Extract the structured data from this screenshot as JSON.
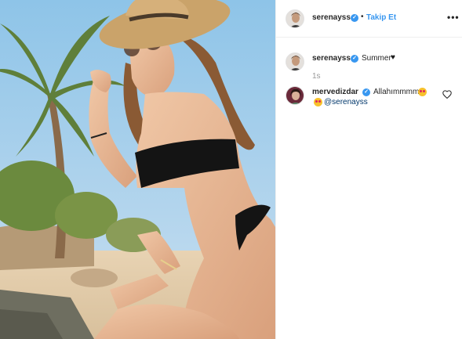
{
  "post": {
    "author": "serenayss",
    "follow_label": "Takip Et",
    "separator": "•",
    "more_label": "•••",
    "caption": {
      "username": "serenayss",
      "text": "Summer",
      "time": "1s"
    },
    "comments": [
      {
        "username": "mervedizdar",
        "text": "Allahımmmm",
        "mention": "@serenayss"
      }
    ]
  },
  "colors": {
    "link_blue": "#3897f0",
    "text": "#262626",
    "muted": "#999999",
    "border": "#efefef",
    "mention": "#00376b"
  },
  "icons": {
    "verified": "verified-badge-icon",
    "more": "more-options-icon",
    "like": "heart-outline-icon",
    "emoji": "heart-eyes-emoji-icon",
    "caption_heart": "black-heart-icon"
  }
}
